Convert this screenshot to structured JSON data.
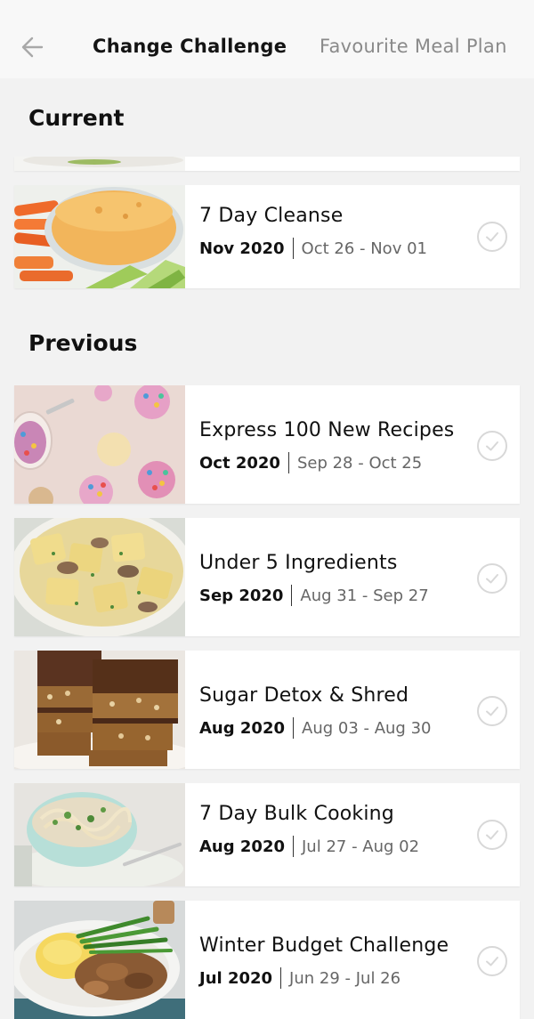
{
  "header": {
    "back_icon": "arrow-left-icon",
    "tabs": [
      {
        "label": "Change Challenge",
        "active": true
      },
      {
        "label": "Favourite Meal Plan",
        "active": false
      }
    ]
  },
  "sections": {
    "current": {
      "title": "Current"
    },
    "previous": {
      "title": "Previous"
    }
  },
  "current_items": [
    {
      "title": "7 Day Cleanse",
      "month": "Nov 2020",
      "range": "Oct 26 - Nov 01",
      "image": "hummus-veggies-photo"
    }
  ],
  "previous_items": [
    {
      "title": "Express 100 New Recipes",
      "month": "Oct 2020",
      "range": "Sep 28 - Oct 25",
      "image": "sprinkle-balls-photo"
    },
    {
      "title": "Under 5 Ingredients",
      "month": "Sep 2020",
      "range": "Aug 31 - Sep 27",
      "image": "ravioli-photo"
    },
    {
      "title": "Sugar Detox & Shred",
      "month": "Aug 2020",
      "range": "Aug 03 - Aug 30",
      "image": "chocolate-slice-photo"
    },
    {
      "title": "7 Day Bulk Cooking",
      "month": "Aug 2020",
      "range": "Jul 27 - Aug 02",
      "image": "pasta-bowl-photo"
    },
    {
      "title": "Winter Budget Challenge",
      "month": "Jul 2020",
      "range": "Jun 29 - Jul 26",
      "image": "stew-mash-photo"
    }
  ],
  "colors": {
    "background": "#f2f2f2",
    "card": "#ffffff",
    "active_tab": "#141414",
    "inactive_tab": "#8a8a8a",
    "check_outline": "#d8d8d8"
  }
}
